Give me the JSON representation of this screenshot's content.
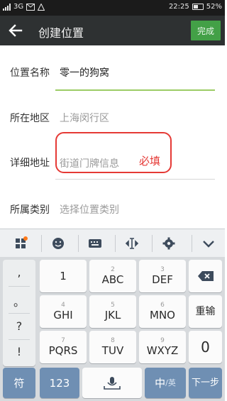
{
  "status_bar": {
    "network": "3G",
    "time": "22:25",
    "battery": "52%",
    "battery_level": 0.52
  },
  "action_bar": {
    "title": "创建位置",
    "done_label": "完成"
  },
  "form": {
    "name_label": "位置名称",
    "name_value": "零一的狗窝",
    "region_label": "所在地区",
    "region_value": "上海闵行区",
    "address_label": "详细地址",
    "address_placeholder": "街道门牌信息",
    "required_annotation": "必填",
    "category_label": "所属类别",
    "category_placeholder": "选择位置类别"
  },
  "keyboard": {
    "symbols": [
      ",",
      "。",
      "?",
      "!"
    ],
    "row1": [
      {
        "small": "",
        "big": "1"
      },
      {
        "small": "2",
        "big": "ABC"
      },
      {
        "small": "3",
        "big": "DEF"
      }
    ],
    "row2": [
      {
        "small": "4",
        "big": "GHI"
      },
      {
        "small": "5",
        "big": "JKL"
      },
      {
        "small": "6",
        "big": "MNO"
      }
    ],
    "row3": [
      {
        "small": "7",
        "big": "PQRS"
      },
      {
        "small": "8",
        "big": "TUV"
      },
      {
        "small": "9",
        "big": "WXYZ"
      }
    ],
    "reenter": "重输",
    "zero": "0",
    "symbol_key": "符",
    "num_key": "123",
    "lang_key_main": "中",
    "lang_key_sub": "/英",
    "next_key": "下一步"
  }
}
